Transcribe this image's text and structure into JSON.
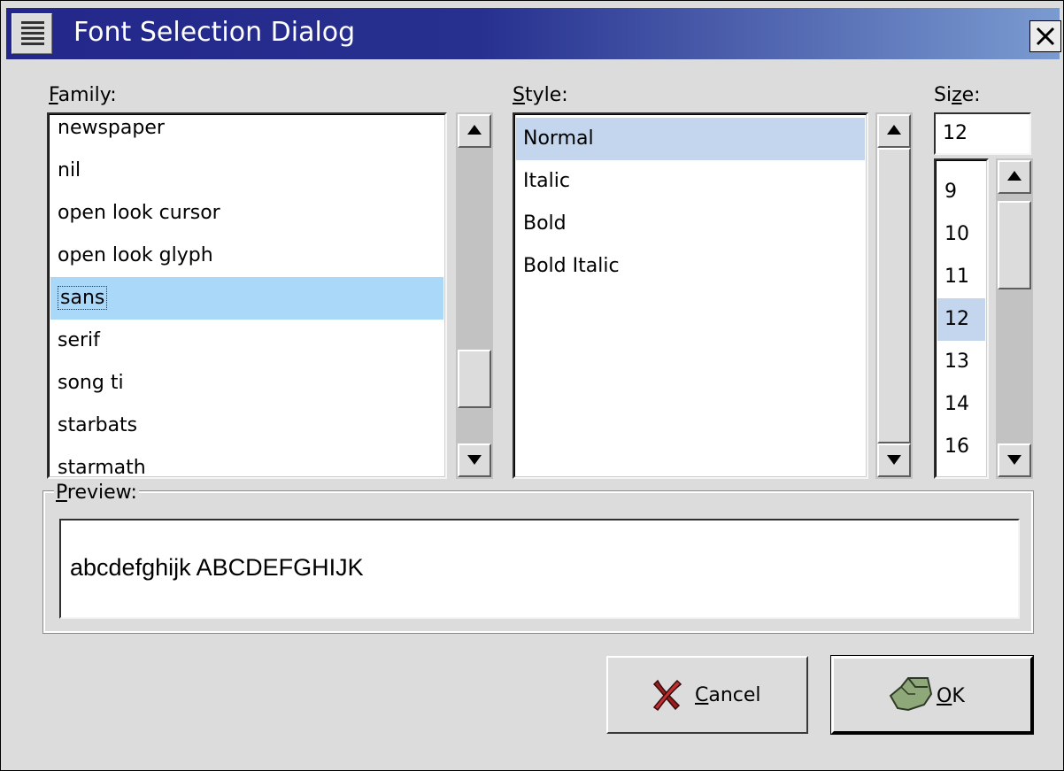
{
  "window": {
    "title": "Font Selection Dialog"
  },
  "family": {
    "label_underlined": "F",
    "label_rest": "amily:",
    "items": [
      "newspaper",
      "nil",
      "open look cursor",
      "open look glyph",
      "sans",
      "serif",
      "song ti",
      "starbats",
      "starmath"
    ],
    "selected": "sans"
  },
  "style": {
    "label_underlined": "S",
    "label_rest": "tyle:",
    "items": [
      "Normal",
      "Italic",
      "Bold",
      "Bold Italic"
    ],
    "selected": "Normal"
  },
  "size": {
    "label_pre": "Si",
    "label_underlined": "z",
    "label_rest": "e:",
    "value": "12",
    "items": [
      "9",
      "10",
      "11",
      "12",
      "13",
      "14",
      "16"
    ],
    "selected": "12"
  },
  "preview": {
    "label_underlined": "P",
    "label_rest": "review:",
    "text": "abcdefghijk ABCDEFGHIJK"
  },
  "buttons": {
    "cancel_underlined": "C",
    "cancel_rest": "ancel",
    "ok_underlined": "O",
    "ok_rest": "K"
  },
  "colors": {
    "title_bar_start": "#23278a",
    "title_bar_end": "#7a9bd0",
    "family_selection": "#a9d8f8",
    "style_selection": "#c3d6ee"
  },
  "icons": {
    "window_menu": "menu-icon",
    "close": "close-icon",
    "cancel": "cancel-x-icon",
    "ok": "ok-hand-icon",
    "scroll_up": "arrow-up-icon",
    "scroll_down": "arrow-down-icon"
  }
}
